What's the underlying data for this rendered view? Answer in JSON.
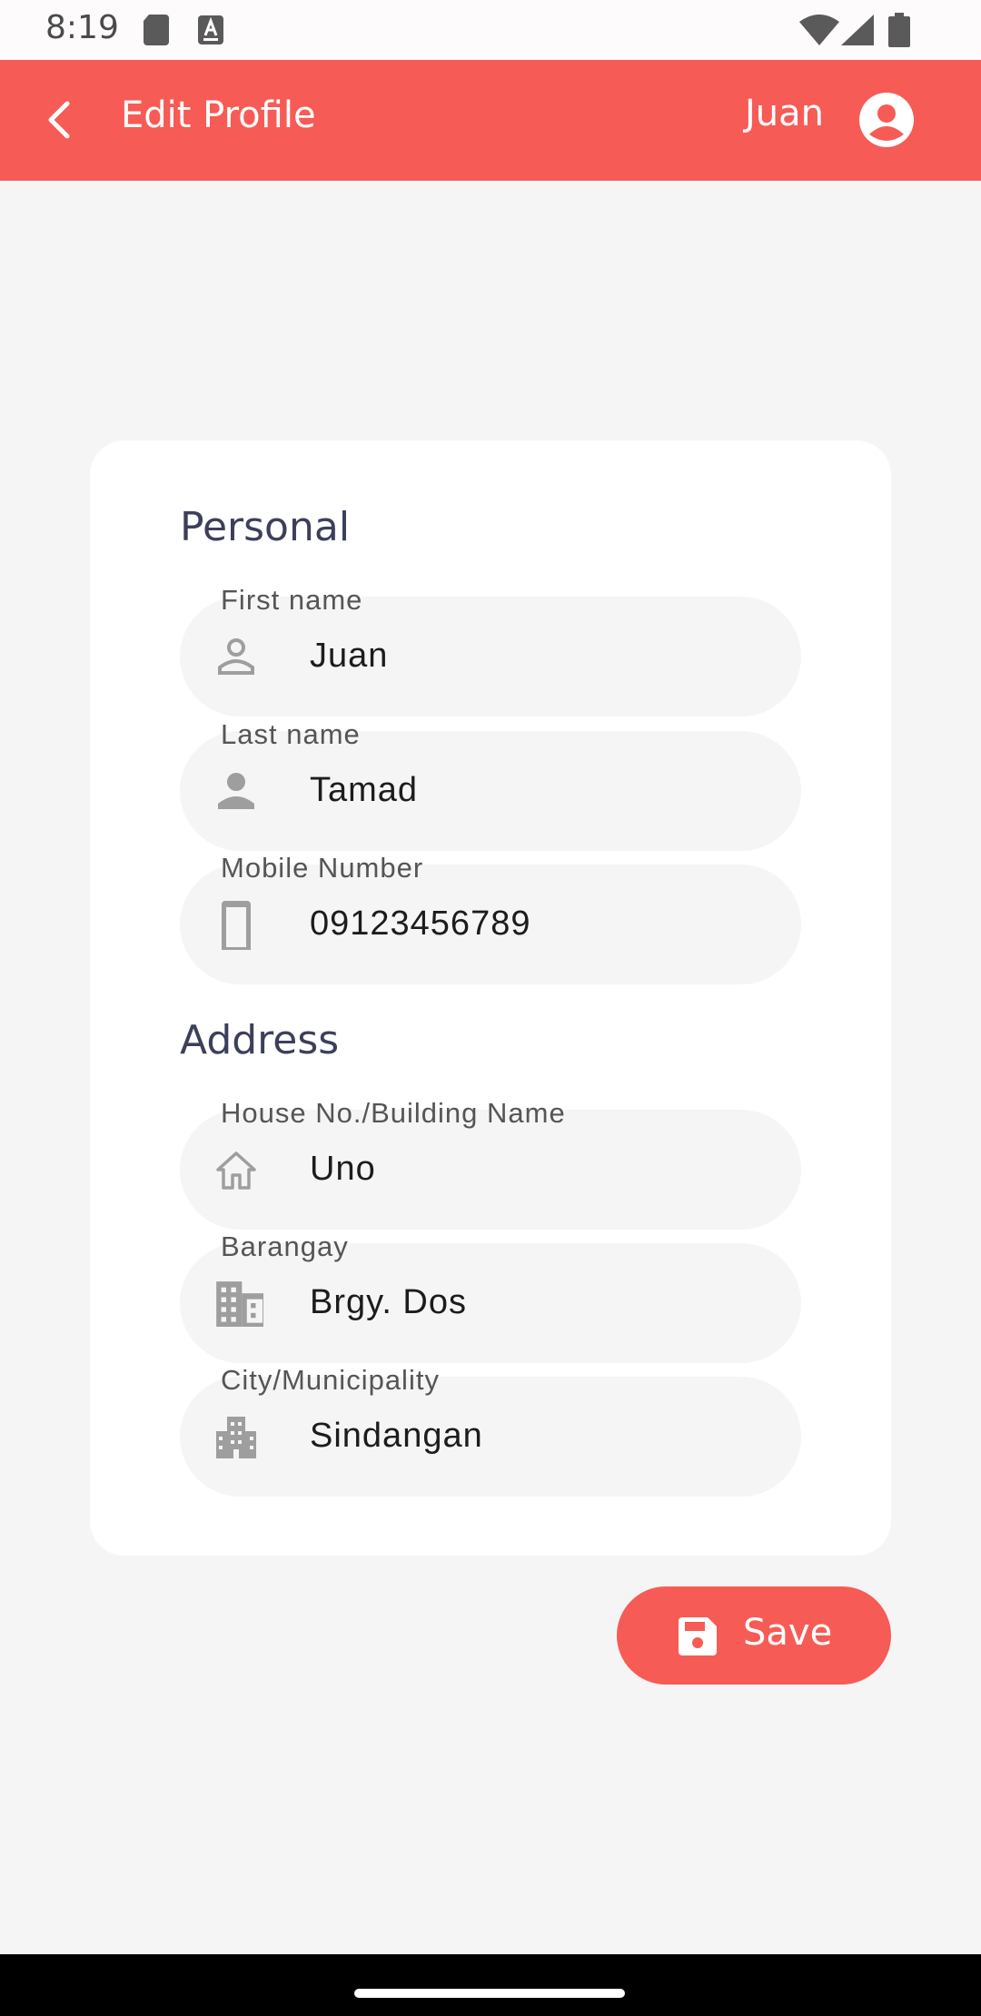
{
  "status_bar": {
    "time": "8:19",
    "icons": [
      "sd-card-icon",
      "a-icon",
      "wifi-icon",
      "signal-icon",
      "battery-icon"
    ]
  },
  "app_bar": {
    "title": "Edit Profile",
    "user_name": "Juan",
    "background_color": "#f75b55"
  },
  "personal": {
    "title": "Personal",
    "fields": [
      {
        "label": "First name",
        "value": "Juan",
        "icon": "person-outline-icon"
      },
      {
        "label": "Last name",
        "value": "Tamad",
        "icon": "person-icon"
      },
      {
        "label": "Mobile Number",
        "value": "09123456789",
        "icon": "phone-icon"
      }
    ]
  },
  "address": {
    "title": "Address",
    "fields": [
      {
        "label": "House No./Building Name",
        "value": "Uno",
        "icon": "house-icon"
      },
      {
        "label": "Barangay",
        "value": "Brgy. Dos",
        "icon": "building-icon"
      },
      {
        "label": "City/Municipality",
        "value": "Sindangan",
        "icon": "city-icon"
      }
    ]
  },
  "save_button": {
    "label": "Save",
    "icon": "save-icon"
  }
}
